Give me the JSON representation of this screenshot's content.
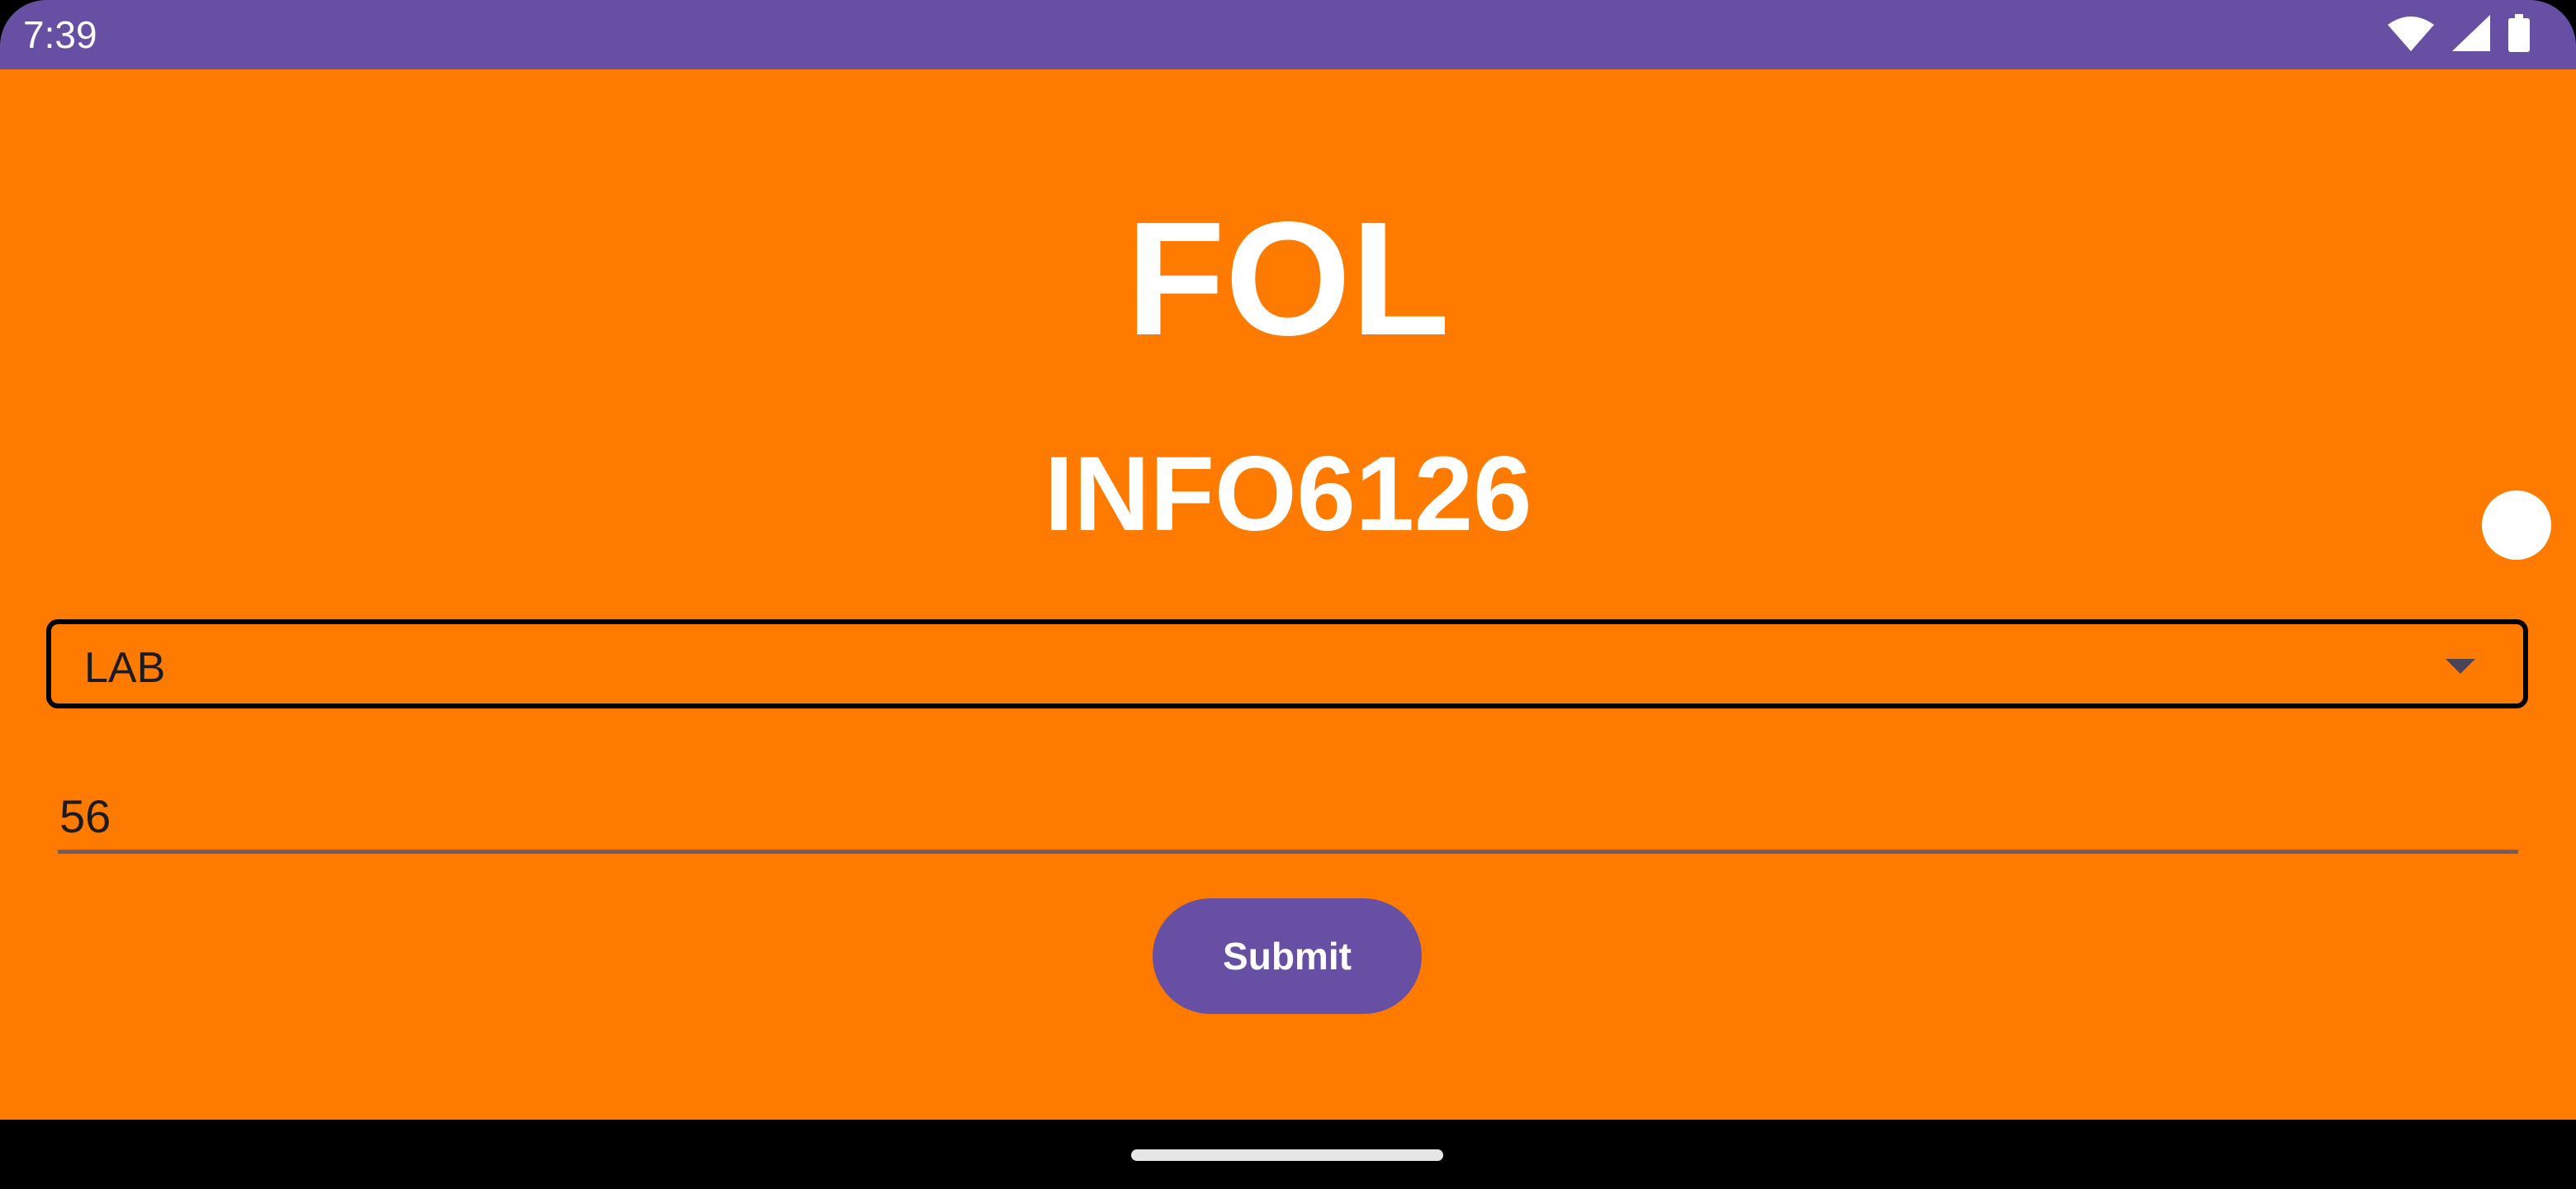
{
  "status_bar": {
    "time": "7:39",
    "icons": [
      "wifi-icon",
      "cellular-signal-icon",
      "battery-icon"
    ],
    "color": "#6750A4"
  },
  "app": {
    "background_color": "#FF7B00",
    "title": "FOL",
    "subtitle": "INFO6126",
    "dropdown": {
      "selected_value": "LAB",
      "icon": "dropdown-arrow-icon"
    },
    "text_field": {
      "value": "56"
    },
    "submit_button": {
      "label": "Submit",
      "color": "#6750A4"
    }
  },
  "navigation_bar": {
    "handle": "home-gesture-handle"
  }
}
